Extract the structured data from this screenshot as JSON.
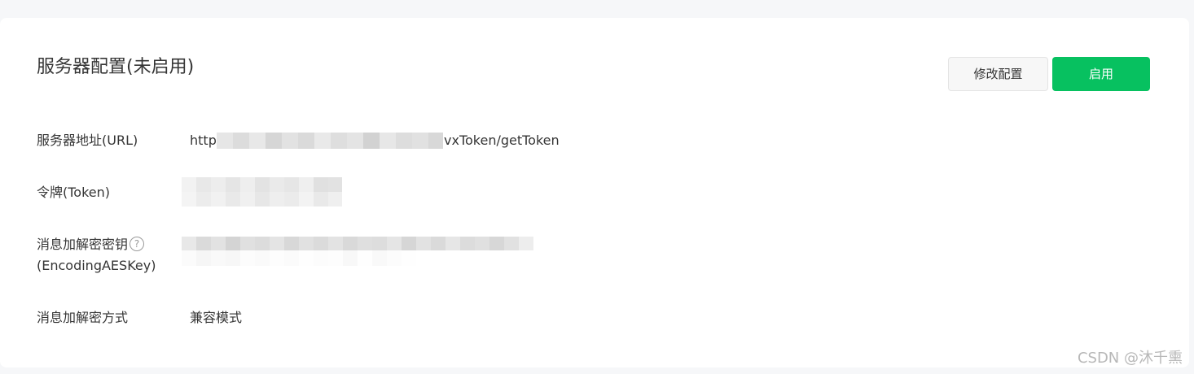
{
  "page": {
    "title": "服务器配置(未启用)"
  },
  "actions": {
    "modify_label": "修改配置",
    "enable_label": "启用"
  },
  "fields": {
    "url": {
      "label": "服务器地址(URL)",
      "value_prefix": "http",
      "value_suffix": "vxToken/getToken"
    },
    "token": {
      "label": "令牌(Token)"
    },
    "aes_key": {
      "label_line1": "消息加解密密钥",
      "label_line2": "(EncodingAESKey)",
      "help_icon": "?"
    },
    "encrypt_mode": {
      "label": "消息加解密方式",
      "value": "兼容模式"
    }
  },
  "watermark": "CSDN @沐千熏",
  "colors": {
    "primary": "#07c160",
    "text": "#353535",
    "background": "#f6f7f9"
  }
}
